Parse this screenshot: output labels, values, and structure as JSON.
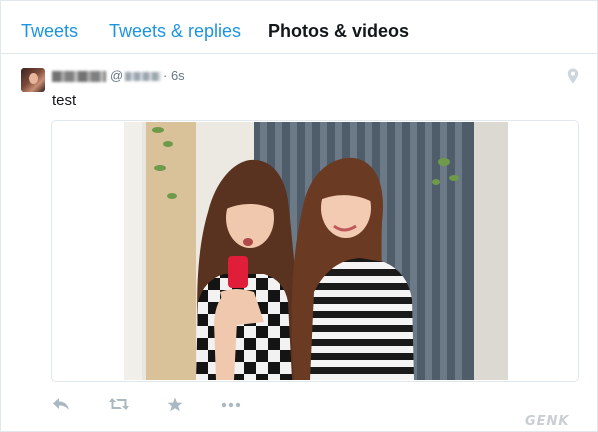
{
  "tabs": [
    {
      "label": "Tweets",
      "active": false
    },
    {
      "label": "Tweets & replies",
      "active": false
    },
    {
      "label": "Photos & videos",
      "active": true
    }
  ],
  "tweet": {
    "author_name": "[redacted]",
    "handle_prefix": "@",
    "handle": "[redacted]",
    "time": "· 6s",
    "text": "test",
    "media": {
      "kind": "photo"
    },
    "actions": [
      {
        "name": "reply",
        "icon": "reply-icon"
      },
      {
        "name": "retweet",
        "icon": "retweet-icon"
      },
      {
        "name": "favorite",
        "icon": "star-icon"
      },
      {
        "name": "more",
        "icon": "more-icon"
      }
    ],
    "location_icon": "map-pin-icon"
  },
  "colors": {
    "link_blue": "#1b95e0",
    "text_dark": "#14171a",
    "text_gray": "#657786",
    "action_gray": "#aab8c2",
    "border": "#e1e8ed"
  },
  "watermark": "GENK"
}
